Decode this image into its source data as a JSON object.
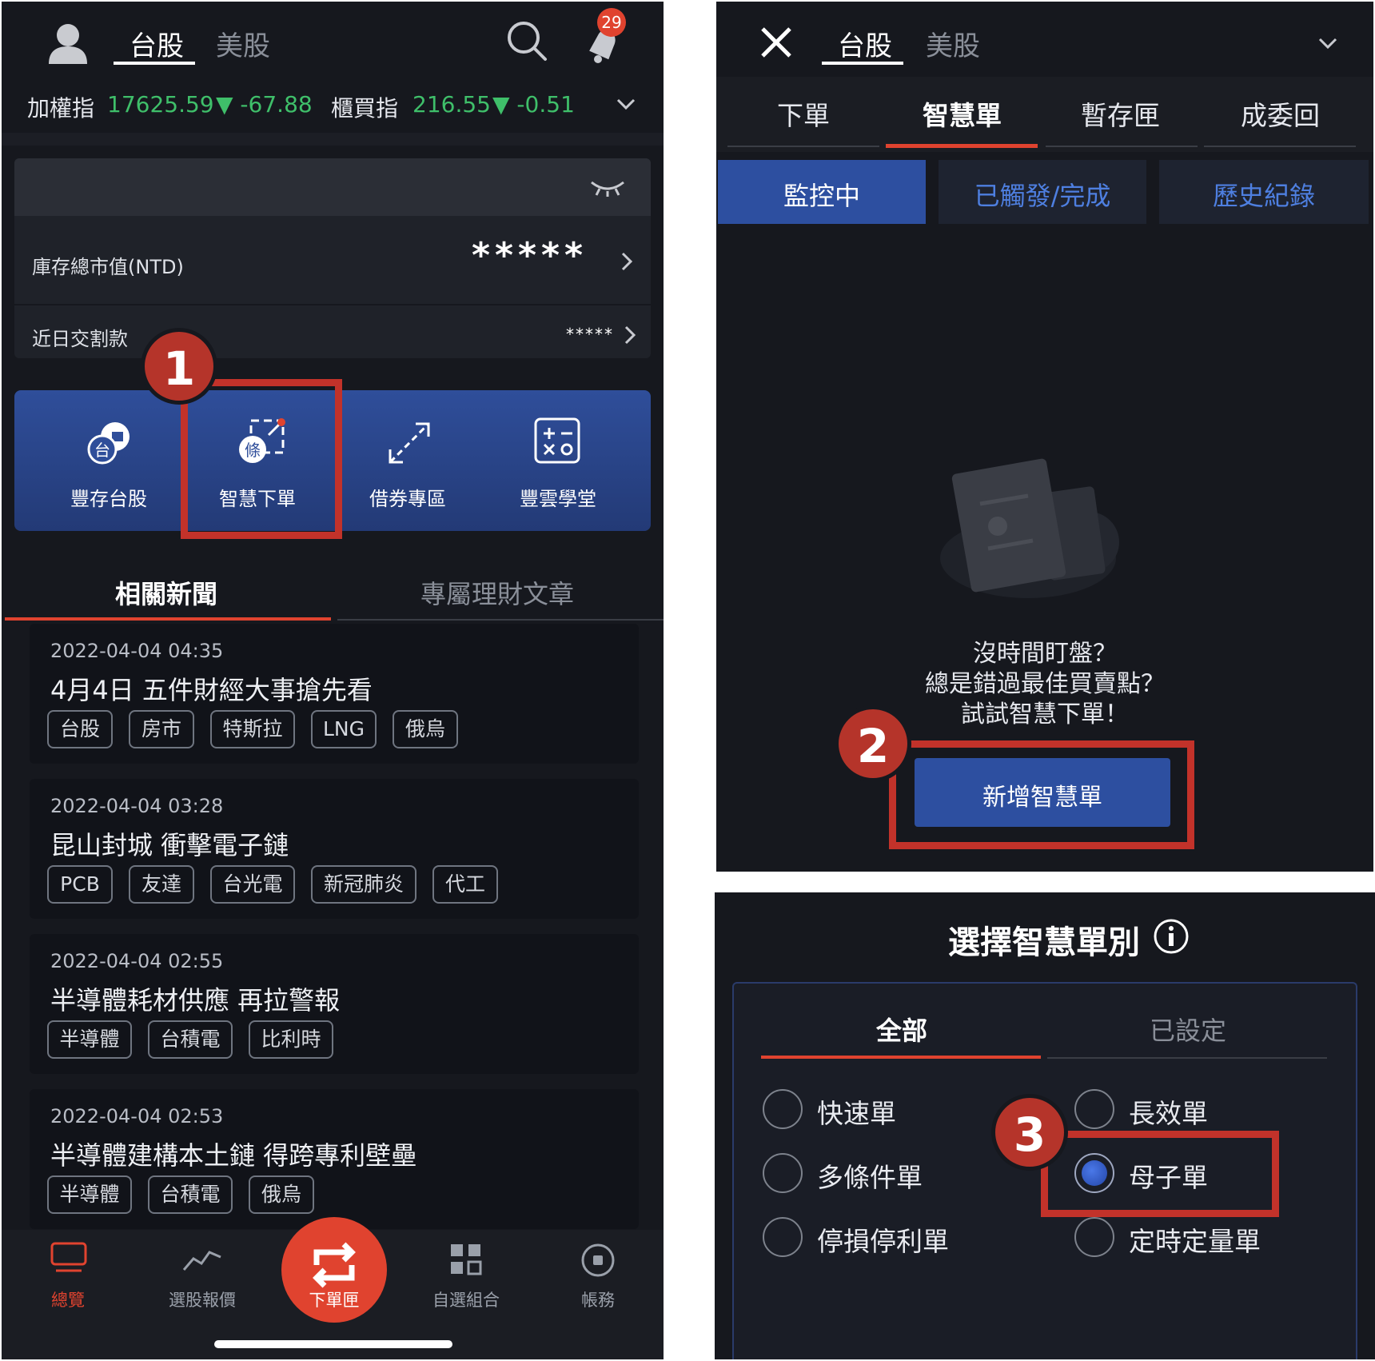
{
  "left_phone": {
    "header": {
      "tab_tw": "台股",
      "tab_us": "美股",
      "notification_count": "29"
    },
    "index_bar": {
      "taiex_label": "加權指",
      "taiex_value": "17625.59",
      "taiex_change": "▼ -67.88",
      "otc_label": "櫃買指",
      "otc_value": "216.55",
      "otc_change": "▼ -0.51"
    },
    "portfolio": {
      "market_value_label": "庫存總市值(NTD)",
      "market_value": "*****",
      "settlement_label": "近日交割款",
      "settlement_value": "*****"
    },
    "quick_actions": [
      {
        "label": "豐存台股",
        "icon": "tw-stock-saving-icon"
      },
      {
        "label": "智慧下單",
        "icon": "smart-order-icon",
        "glyph": "條"
      },
      {
        "label": "借券專區",
        "icon": "securities-lending-icon"
      },
      {
        "label": "豐雲學堂",
        "icon": "calculator-icon"
      }
    ],
    "news_tabs": {
      "related": "相關新聞",
      "articles": "專屬理財文章"
    },
    "news": [
      {
        "date": "2022-04-04 04:35",
        "title": "4月4日 五件財經大事搶先看",
        "tags": [
          "台股",
          "房市",
          "特斯拉",
          "LNG",
          "俄烏"
        ]
      },
      {
        "date": "2022-04-04 03:28",
        "title": "昆山封城 衝擊電子鏈",
        "tags": [
          "PCB",
          "友達",
          "台光電",
          "新冠肺炎",
          "代工"
        ]
      },
      {
        "date": "2022-04-04 02:55",
        "title": "半導體耗材供應 再拉警報",
        "tags": [
          "半導體",
          "台積電",
          "比利時"
        ]
      },
      {
        "date": "2022-04-04 02:53",
        "title": "半導體建構本土鏈 得跨專利壁壘",
        "tags": [
          "半導體",
          "台積電",
          "俄烏"
        ]
      }
    ],
    "bottom_nav": {
      "overview": "總覽",
      "quotes": "選股報價",
      "order": "下單匣",
      "watchlist": "自選組合",
      "account": "帳務"
    }
  },
  "top_right": {
    "header": {
      "tab_tw": "台股",
      "tab_us": "美股"
    },
    "order_tabs": [
      "下單",
      "智慧單",
      "暫存匣",
      "成委回"
    ],
    "sub_tabs": [
      "監控中",
      "已觸發/完成",
      "歷史紀錄"
    ],
    "empty_message": [
      "沒時間盯盤？",
      "總是錯過最佳買賣點？",
      "試試智慧下單！"
    ],
    "add_button": "新增智慧單"
  },
  "bottom_right": {
    "title": "選擇智慧單別",
    "tabs": {
      "all": "全部",
      "configured": "已設定"
    },
    "options": [
      "快速單",
      "長效單",
      "多條件單",
      "母子單",
      "停損停利單",
      "定時定量單"
    ],
    "selected": "母子單"
  },
  "steps": [
    "1",
    "2",
    "3"
  ],
  "colors": {
    "accent_red": "#e0432f",
    "highlight_red": "#c2322a",
    "primary_blue": "#2d4fa0",
    "up_down_green": "#3fbf6a",
    "background": "#16181e"
  }
}
